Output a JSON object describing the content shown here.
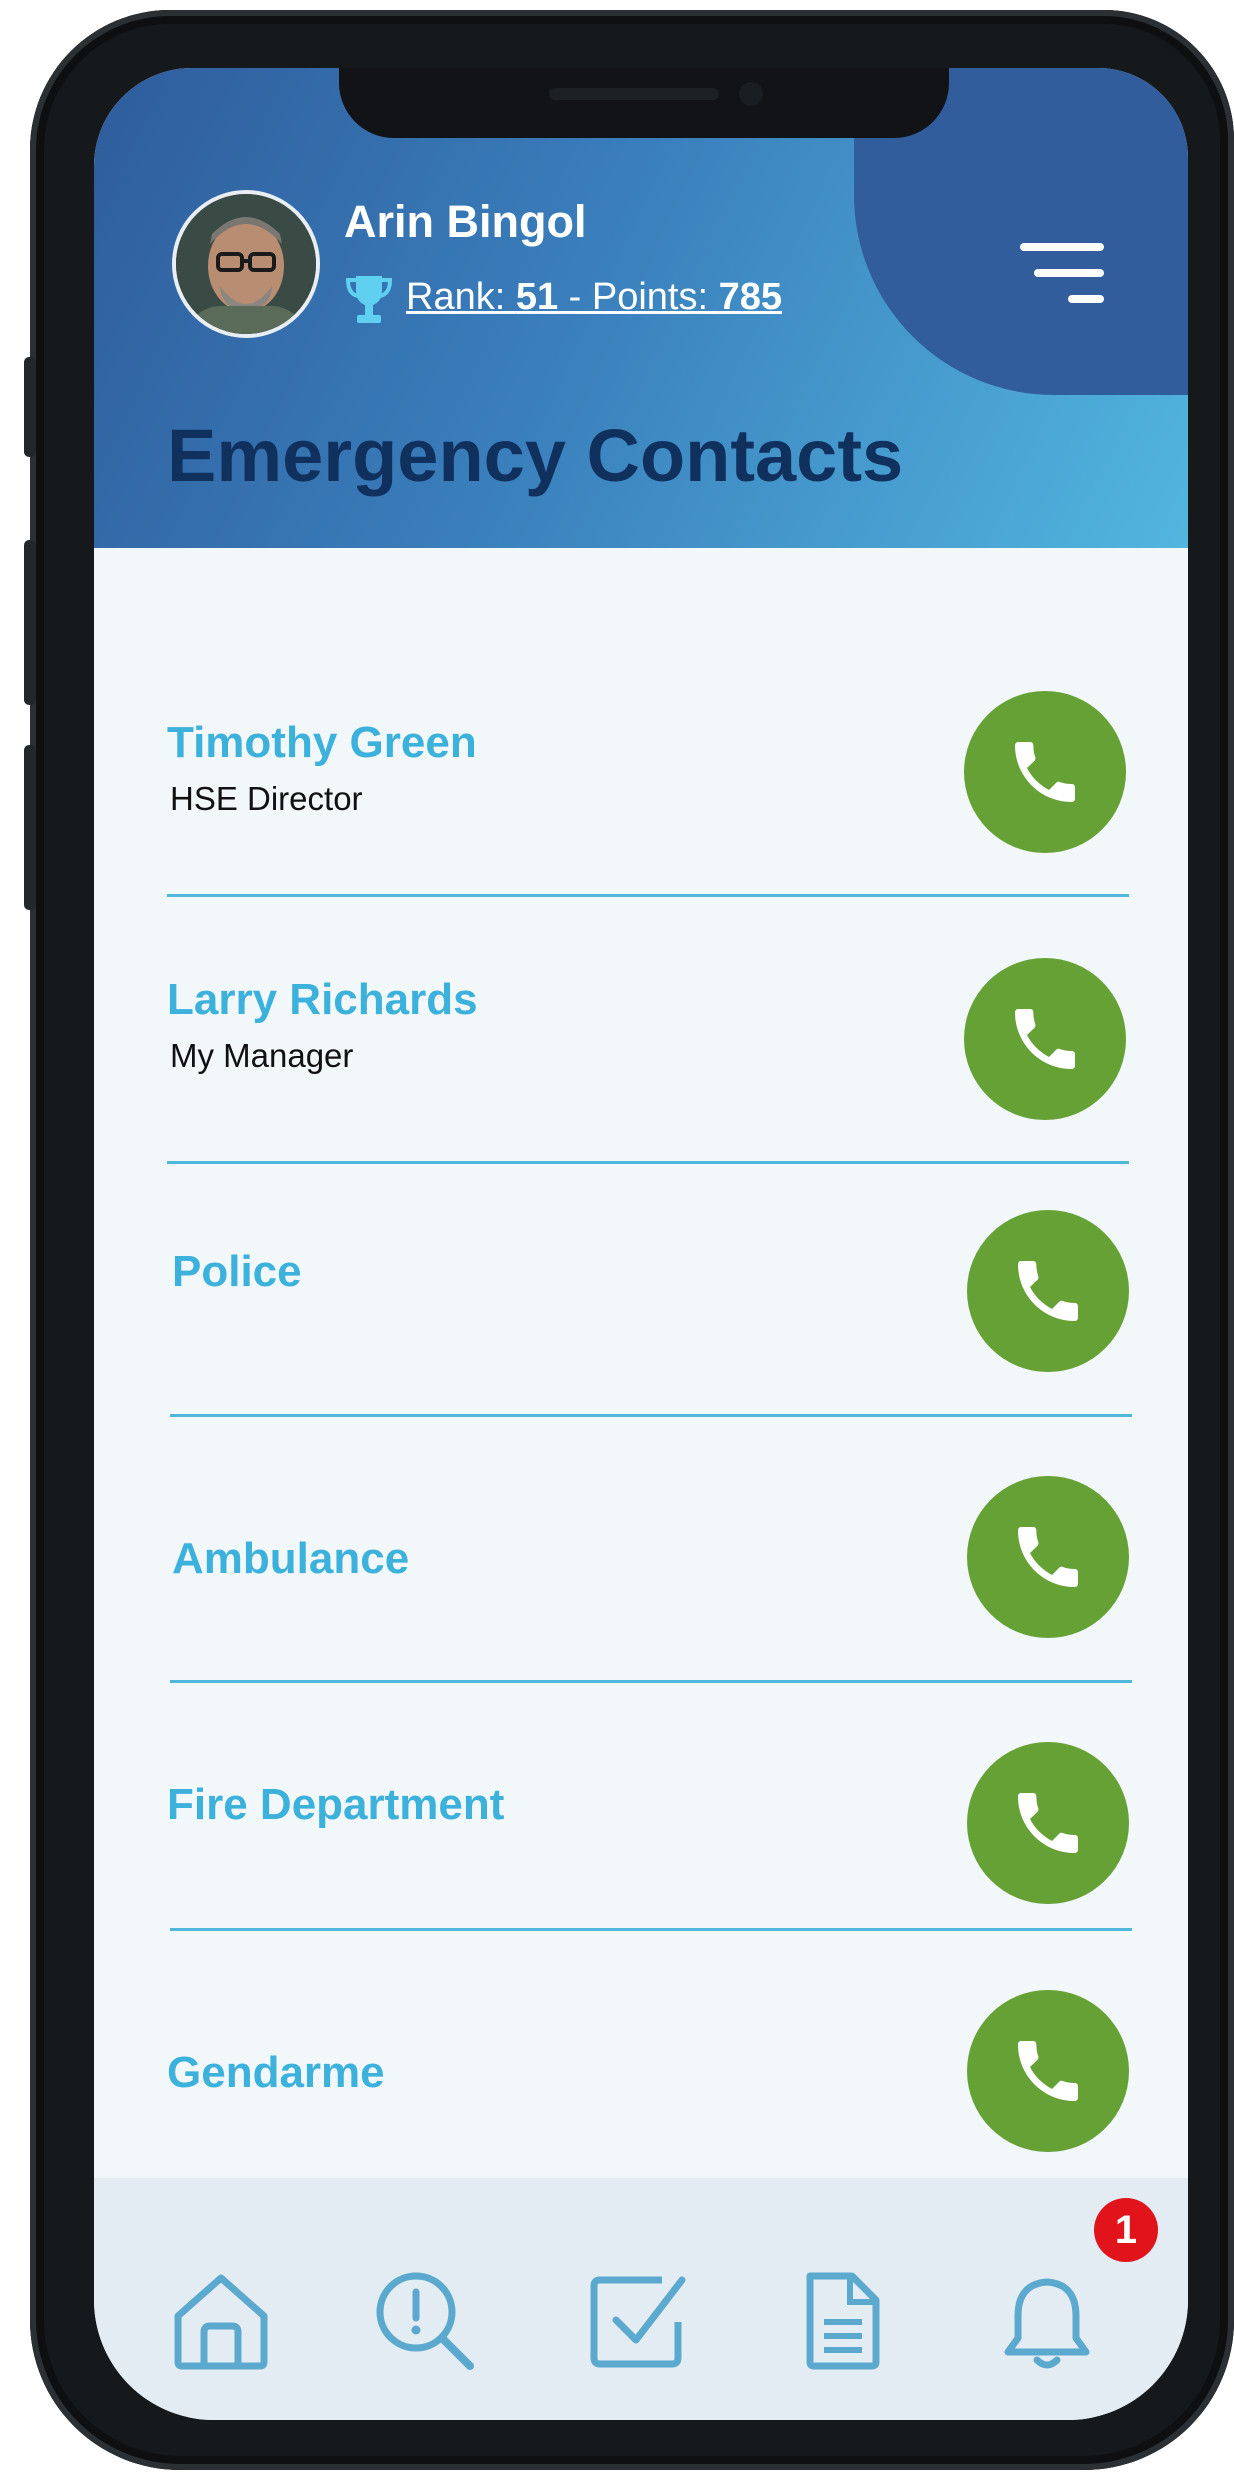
{
  "user": {
    "name": "Arin Bingol",
    "rank_prefix": "Rank: ",
    "rank": "51",
    "points_prefix": " - Points: ",
    "points": "785"
  },
  "page": {
    "title": "Emergency Contacts"
  },
  "contacts": [
    {
      "name": "Timothy Green",
      "role": "HSE Director"
    },
    {
      "name": "Larry Richards",
      "role": "My Manager"
    },
    {
      "name": "Police",
      "role": ""
    },
    {
      "name": "Ambulance",
      "role": ""
    },
    {
      "name": "Fire Department",
      "role": ""
    },
    {
      "name": "Gendarme",
      "role": ""
    }
  ],
  "tabbar": {
    "items": [
      "home-icon",
      "search-alert-icon",
      "checkbox-icon",
      "document-icon",
      "bell-icon"
    ],
    "notification_count": "1"
  },
  "colors": {
    "header_dark": "#2f5c9c",
    "header_light": "#52b6df",
    "title": "#10305e",
    "contact_name": "#3cb1dc",
    "call_button": "#66a136",
    "divider": "#4fb7db",
    "icon": "#5ba9cf",
    "badge": "#e0141a"
  }
}
